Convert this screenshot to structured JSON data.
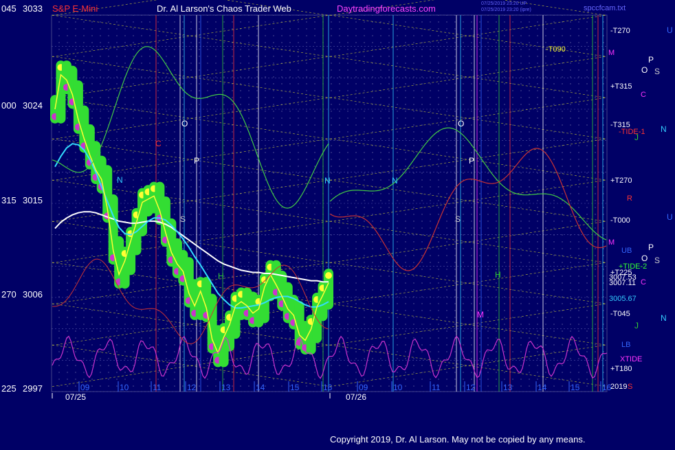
{
  "header": {
    "left_time": "045",
    "left_price": "3033",
    "instrument": "S&P E-Mini",
    "site_title": "Dr. Al Larson's Chaos Trader Web",
    "site_url": "Daytradingforecasts.com",
    "stamp_1": "07/25/2019 23:20 UP",
    "stamp_2": "07/25/2019 23:20 (ipre)",
    "file_name": "spccfcam.txt"
  },
  "footer": {
    "copyright": "Copyright 2019, Dr. Al Larson. May not be copied by any means."
  },
  "colors": {
    "background": "#000066",
    "price_bars": "#33dd33",
    "close_line": "#ffff33",
    "ma_fast": "#33ddff",
    "ma_slow": "#ffffff",
    "oscillator": "#cc33cc",
    "green_tide": "#44cc44",
    "red_tide": "#cc3333",
    "grid_lines": "#dddd33",
    "time_labels": "#3366ff"
  },
  "chart_data": {
    "type": "line",
    "title": "S&P E-Mini",
    "subtitle": "Dr. Al Larson's Chaos Trader Web",
    "ylim": [
      2997,
      3033
    ],
    "y_price_ticks": [
      "3033",
      "3024",
      "3015",
      "3006",
      "2997"
    ],
    "y_angle_ticks": [
      "045",
      "000",
      "315",
      "270",
      "225"
    ],
    "x_date_labels": [
      "07/25",
      "07/26"
    ],
    "x_hour_labels_day1": [
      "09",
      "10",
      "11",
      "12",
      "13",
      "14",
      "15",
      "16"
    ],
    "x_hour_labels_day2": [
      "09",
      "10",
      "11",
      "12",
      "13",
      "14",
      "15",
      "16"
    ],
    "price_markers": [
      "3007.53",
      "3007.11",
      "3005.67"
    ],
    "right_flux_labels": [
      "-T270",
      "M",
      "-T090",
      "+T315",
      "C",
      "-T315",
      "-TIDE-1",
      "+T270",
      "R",
      "-T000",
      "M",
      "UB",
      "+TIDE-2",
      "+T225",
      "C",
      "-T045",
      "LB",
      "XTIDE",
      "+T180",
      "2019",
      "S"
    ],
    "planet_labels": [
      "U",
      "P",
      "O",
      "S",
      "N",
      "J",
      "U",
      "P",
      "O",
      "S",
      "N",
      "J"
    ],
    "event_letters": [
      "N",
      "O",
      "P",
      "C",
      "S",
      "H",
      "N",
      "O",
      "P",
      "N",
      "S",
      "H",
      "M"
    ],
    "series": [
      {
        "name": "close",
        "values": [
          3024,
          3027.3,
          3026.8,
          3025.4,
          3023,
          3021.2,
          3019.6,
          3018.2,
          3017.3,
          3014.5,
          3010.5,
          3008.2,
          3009.5,
          3011.4,
          3013.2,
          3015.1,
          3015.4,
          3015.7,
          3014.3,
          3012.2,
          3010.3,
          3009.2,
          3008.5,
          3006.4,
          3005.2,
          3006.6,
          3005.0,
          3002.0,
          3000.7,
          3002.2,
          3003.4,
          3005.2,
          3005.6,
          3005.2,
          3004.5,
          3004.9,
          3007.0,
          3008.2,
          3007.2,
          3006.1,
          3004.9,
          3004.3,
          3002.4,
          3001.9,
          3003.0,
          3005.1,
          3006.2,
          3007.4
        ]
      },
      {
        "name": "ma_fast",
        "values": [
          3018.5,
          3019.5,
          3020.3,
          3020.7,
          3020.6,
          3020.1,
          3019.2,
          3018.0,
          3016.6,
          3015.2,
          3013.8,
          3012.7,
          3012.1,
          3012.0,
          3012.3,
          3012.8,
          3013.3,
          3013.6,
          3013.6,
          3013.4,
          3012.9,
          3012.3,
          3011.6,
          3010.8,
          3009.9,
          3009.1,
          3008.2,
          3007.3,
          3006.4,
          3005.8,
          3005.3,
          3005.0,
          3005.0,
          3005.1,
          3005.2,
          3005.3,
          3005.5,
          3005.8,
          3006.0,
          3006.1,
          3006.1,
          3005.9,
          3005.6,
          3005.3,
          3005.1,
          3005.1,
          3005.3,
          3005.6
        ]
      },
      {
        "name": "ma_slow",
        "values": [
          3012.6,
          3013.2,
          3013.6,
          3013.9,
          3014.1,
          3014.2,
          3014.2,
          3014.1,
          3013.9,
          3013.7,
          3013.5,
          3013.3,
          3013.2,
          3013.1,
          3013.1,
          3013.2,
          3013.3,
          3013.3,
          3013.2,
          3013.0,
          3012.7,
          3012.3,
          3011.9,
          3011.5,
          3011.1,
          3010.7,
          3010.3,
          3009.9,
          3009.5,
          3009.2,
          3009.0,
          3008.8,
          3008.6,
          3008.5,
          3008.4,
          3008.4,
          3008.3,
          3008.3,
          3008.2,
          3008.1,
          3008.0,
          3007.9,
          3007.8,
          3007.7,
          3007.6,
          3007.6,
          3007.5,
          3007.5
        ]
      }
    ]
  }
}
